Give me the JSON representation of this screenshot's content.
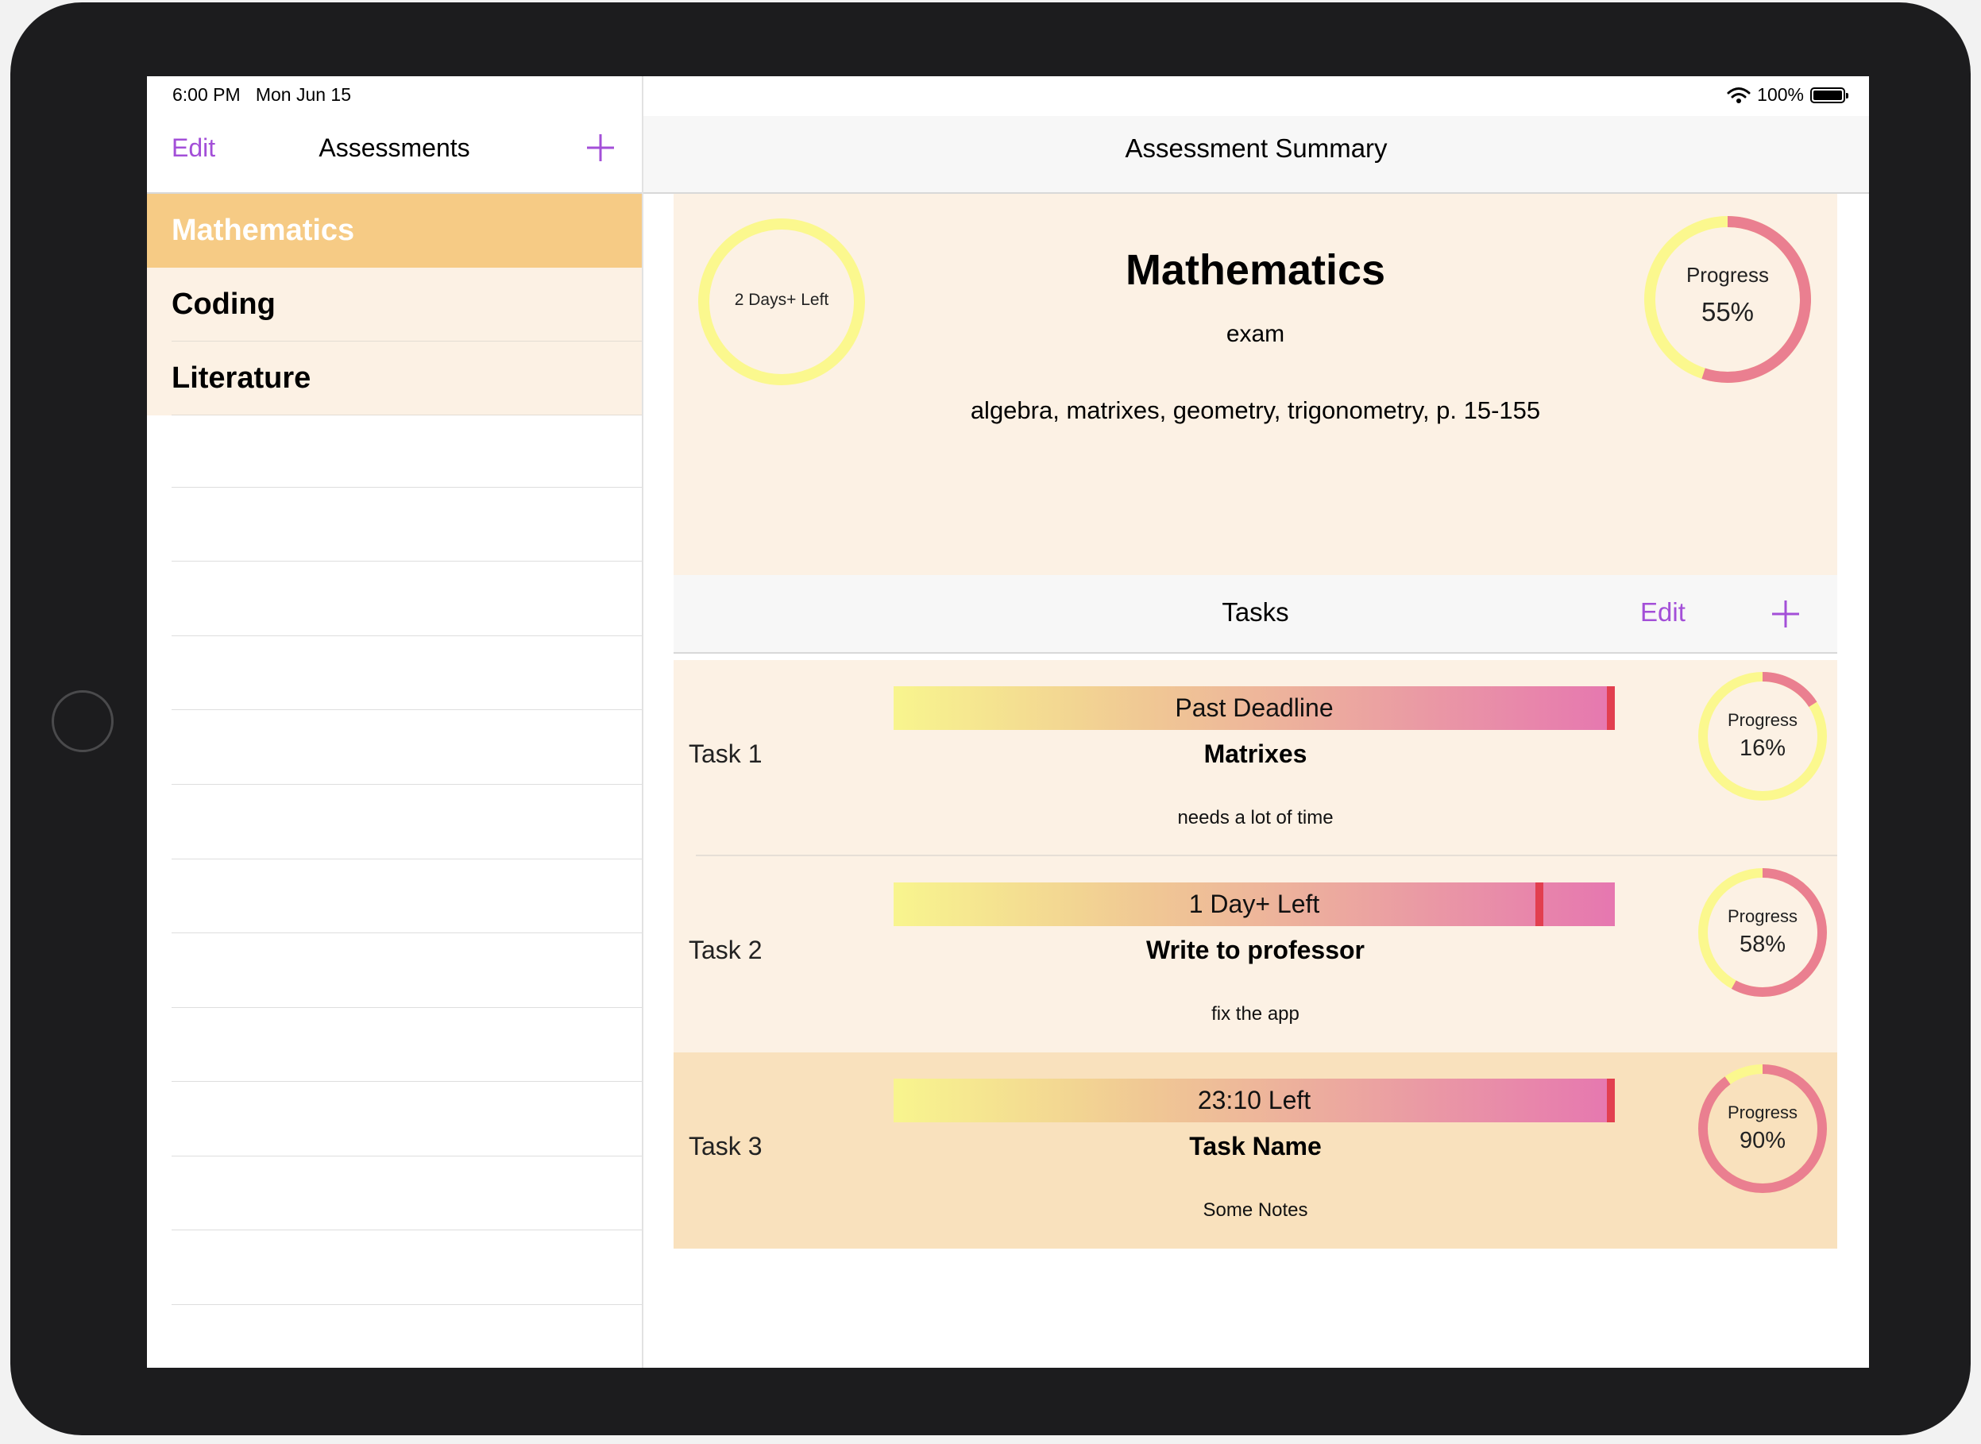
{
  "status": {
    "time": "6:00 PM",
    "date": "Mon Jun 15",
    "battery": "100%"
  },
  "sidebar": {
    "edit_label": "Edit",
    "title": "Assessments",
    "items": [
      {
        "label": "Mathematics",
        "selected": true
      },
      {
        "label": "Coding",
        "selected": false
      },
      {
        "label": "Literature",
        "selected": false
      }
    ]
  },
  "detail": {
    "nav_title": "Assessment Summary",
    "summary": {
      "days_left": "2 Days+  Left",
      "title": "Mathematics",
      "type": "exam",
      "description": "algebra, matrixes, geometry, trigonometry, p. 15-155",
      "progress_label": "Progress",
      "progress_text": "55%",
      "progress_value": 0.55
    },
    "tasks_header": {
      "title": "Tasks",
      "edit_label": "Edit"
    },
    "tasks": [
      {
        "name": "Task 1",
        "deadline": "Past Deadline",
        "title": "Matrixes",
        "notes": "needs a lot of time",
        "progress_label": "Progress",
        "progress_text": "16%",
        "progress": 0.16,
        "time_elapsed": 0.99
      },
      {
        "name": "Task 2",
        "deadline": "1 Day+  Left",
        "title": "Write to professor",
        "notes": "fix the app",
        "progress_label": "Progress",
        "progress_text": "58%",
        "progress": 0.58,
        "time_elapsed": 0.89
      },
      {
        "name": "Task 3",
        "deadline": "23:10  Left",
        "title": "Task Name",
        "notes": "Some Notes",
        "progress_label": "Progress",
        "progress_text": "90%",
        "progress": 0.9,
        "time_elapsed": 0.99
      }
    ]
  },
  "colors": {
    "accent": "#a34fd8",
    "selected_row": "#f6cb85",
    "row_bg": "#fcf1e4",
    "ring_yellow": "#fbf88e",
    "ring_pink": "#ea7f90",
    "deadline_marker": "#e23f4f"
  }
}
